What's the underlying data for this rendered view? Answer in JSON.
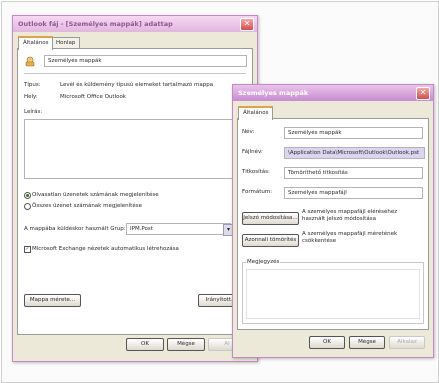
{
  "window1": {
    "title": "Outlook fáj - [Személyes mappák] adattap",
    "tabs": [
      "Általános",
      "Honlap"
    ],
    "folder_name": "Személyes mappák",
    "type_label": "Típus:",
    "type_value": "Levél és küldemény típusú elemeket tartalmazó mappa",
    "location_label": "Hely:",
    "location_value": "Microsoft Office Outlook",
    "description_label": "Leírás:",
    "radio_unread": "Olvasatlan üzenetek számának megjelenítése",
    "radio_total": "Összes üzenet számának megjelenítése",
    "post_label": "A mappába küldéskor használt Grup:",
    "post_value": "IPM.Post",
    "exchange_check": "Microsoft Exchange nézetek automatikus létrehozása",
    "folder_size_button": "Mappa mérete...",
    "fragment_button": "Irányított...",
    "ok_button": "OK",
    "cancel_button": "Mégse",
    "apply_button": "Al"
  },
  "window2": {
    "title": "Személyes mappák",
    "tab": "Általános",
    "name_label": "Név:",
    "name_value": "Személyes mappák",
    "filename_label": "Fájlnév:",
    "filename_value": "\\Application Data\\Microsoft\\Outlook\\Outlook.pst",
    "encryption_label": "Titkosítás:",
    "encryption_value": "Tömöríthető titkosítás",
    "format_label": "Formátum:",
    "format_value": "Személyes mappafájl",
    "password_button": "Jelszó módosítása...",
    "password_desc": "A személyes mappafájl eléréséhez használt jelszó módosítása",
    "compact_button": "Azonnali tömörítés",
    "compact_desc": "A személyes mappafájl méretének csökkentése",
    "comment_label": "Megjegyzés",
    "ok_button": "OK",
    "cancel_button": "Mégse",
    "apply_button": "Alkalaz"
  }
}
